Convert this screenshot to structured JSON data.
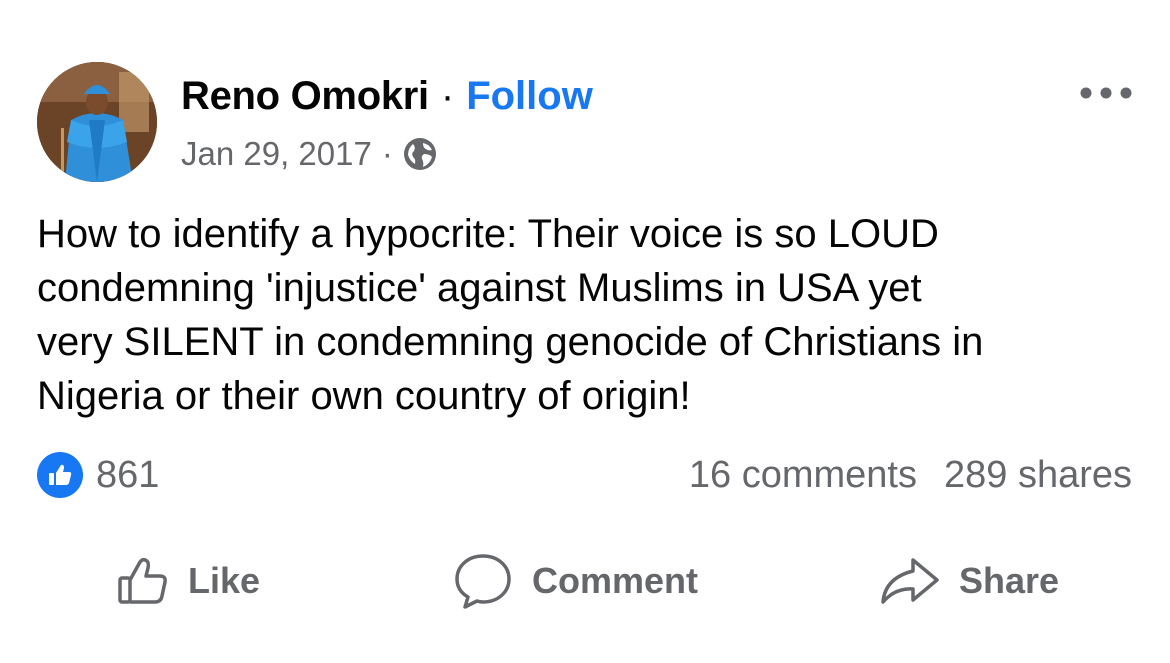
{
  "post": {
    "author": "Reno Omokri",
    "separator": "·",
    "follow_label": "Follow",
    "date": "Jan 29, 2017",
    "meta_separator": "·",
    "audience_icon": "globe-icon",
    "text_lines": [
      "How to identify a hypocrite: Their voice is so LOUD",
      "condemning 'injustice' against Muslims in USA yet",
      "very SILENT in condemning genocide of Christians in",
      "Nigeria or their own country of origin!"
    ]
  },
  "stats": {
    "reaction_icon": "like-reaction-icon",
    "reaction_count": "861",
    "comments": "16 comments",
    "shares": "289 shares"
  },
  "actions": {
    "like_label": "Like",
    "comment_label": "Comment",
    "share_label": "Share"
  },
  "colors": {
    "accent": "#1877f2",
    "text_primary": "#050505",
    "text_secondary": "#65676b",
    "background": "#ffffff"
  }
}
